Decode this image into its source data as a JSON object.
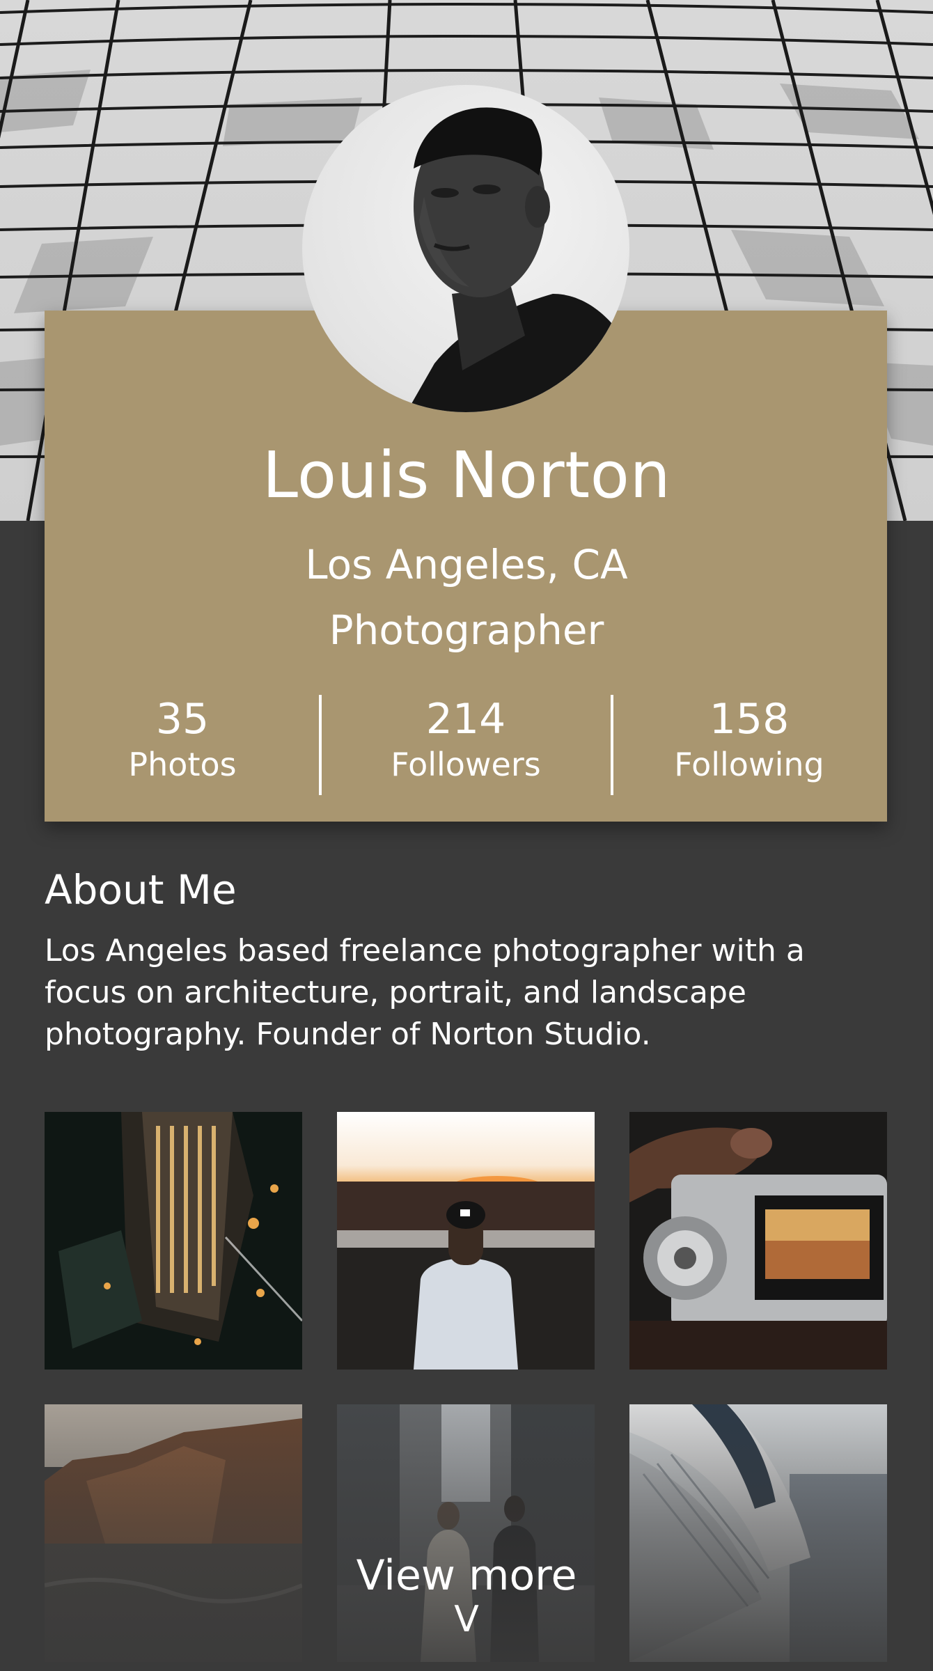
{
  "profile": {
    "name": "Louis Norton",
    "location": "Los Angeles, CA",
    "role": "Photographer"
  },
  "stats": [
    {
      "value": "35",
      "label": "Photos"
    },
    {
      "value": "214",
      "label": "Followers"
    },
    {
      "value": "158",
      "label": "Following"
    }
  ],
  "about": {
    "title": "About Me",
    "text": "Los Angeles based freelance photographer with a focus on architecture, portrait, and landscape photography. Founder of Norton Studio."
  },
  "gallery": {
    "photos": [
      {
        "subject": "city-night-aerial"
      },
      {
        "subject": "man-sunset-lake"
      },
      {
        "subject": "camera-in-hand"
      },
      {
        "subject": "coastal-cliffs"
      },
      {
        "subject": "city-street-people"
      },
      {
        "subject": "modern-architecture"
      }
    ],
    "view_more_label": "View more",
    "view_more_icon": "V"
  },
  "colors": {
    "card": "#a99670",
    "background": "#3a3a3a",
    "text": "#ffffff"
  }
}
